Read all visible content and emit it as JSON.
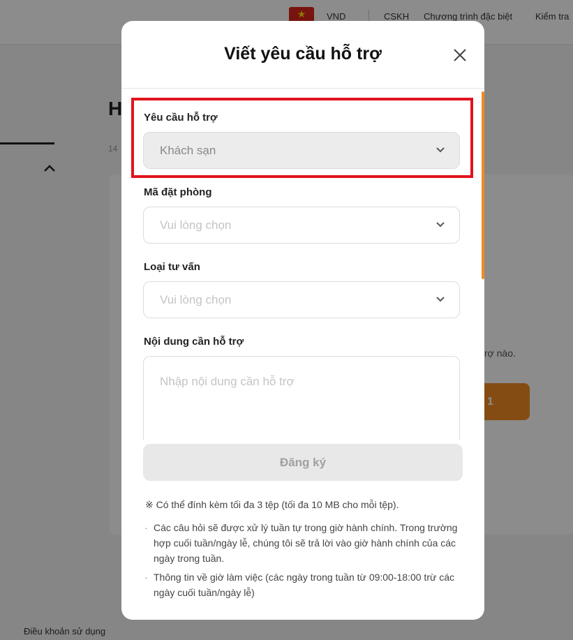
{
  "background": {
    "currency": "VND",
    "nav": [
      "CSKH",
      "Chương trình đặc biệt",
      "Kiểm tra"
    ],
    "heading": "H",
    "subtext": "14",
    "card_text": "trợ nào.",
    "orange_button": "1",
    "footer_link": "Điều khoản sử dụng"
  },
  "modal": {
    "title": "Viết yêu cầu hỗ trợ",
    "fields": {
      "support_request": {
        "label": "Yêu cầu hỗ trợ",
        "value": "Khách sạn"
      },
      "booking_code": {
        "label": "Mã đặt phòng",
        "placeholder": "Vui lòng chọn"
      },
      "consult_type": {
        "label": "Loại tư vấn",
        "placeholder": "Vui lòng chọn"
      },
      "content": {
        "label": "Nội dung cần hỗ trợ",
        "placeholder": "Nhập nội dung cần hỗ trợ"
      }
    },
    "submit_label": "Đăng ký",
    "attachment_note": "※ Có thể đính kèm tối đa 3 tệp (tối đa 10 MB cho mỗi tệp).",
    "info_items": [
      "Các câu hỏi sẽ được xử lý tuần tự trong giờ hành chính. Trong trường hợp cuối tuần/ngày lễ, chúng tôi sẽ trả lời vào giờ hành chính của các ngày trong tuần.",
      "Thông tin về giờ làm việc (các ngày trong tuần từ 09:00-18:00 trừ các ngày cuối tuần/ngày lễ)"
    ],
    "bullet": "·"
  },
  "colors": {
    "accent": "#f08a24",
    "highlight": "#e0141e"
  }
}
